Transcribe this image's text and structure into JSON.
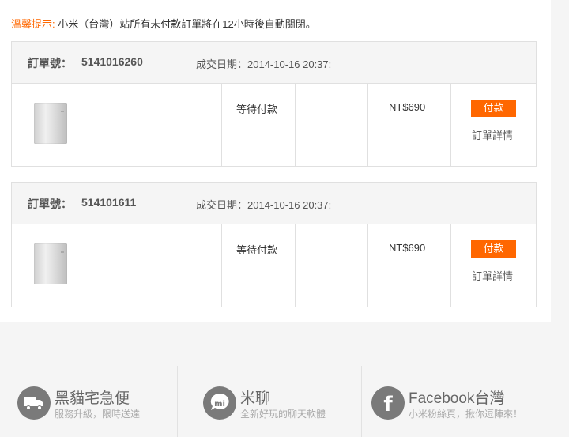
{
  "notice": {
    "label": "溫馨提示:",
    "text": "小米（台灣）站所有未付款訂單將在12小時後自動關閉。"
  },
  "orders": [
    {
      "order_no_label": "訂單號：",
      "order_no": "5141016260",
      "date_label": "成交日期：2014-10-16 20:37:",
      "status": "等待付款",
      "price": "NT$690",
      "pay_label": "付款",
      "detail_label": "訂單詳情"
    },
    {
      "order_no_label": "訂單號：",
      "order_no": "514101611",
      "date_label": "成交日期：2014-10-16 20:37:",
      "status": "等待付款",
      "price": "NT$690",
      "pay_label": "付款",
      "detail_label": "訂單詳情"
    }
  ],
  "footer": [
    {
      "icon": "truck-icon",
      "title": "黑貓宅急便",
      "subtitle": "服務升級，限時送達"
    },
    {
      "icon": "mi-chat-icon",
      "icon_text": "mi",
      "title": "米聊",
      "subtitle": "全新好玩的聊天軟體"
    },
    {
      "icon": "facebook-icon",
      "icon_text": "f",
      "title": "Facebook台灣",
      "subtitle": "小米粉絲頁，揪你逗陣來！"
    }
  ],
  "colors": {
    "accent": "#ff6700",
    "footer_icon": "#7a7a7a"
  }
}
